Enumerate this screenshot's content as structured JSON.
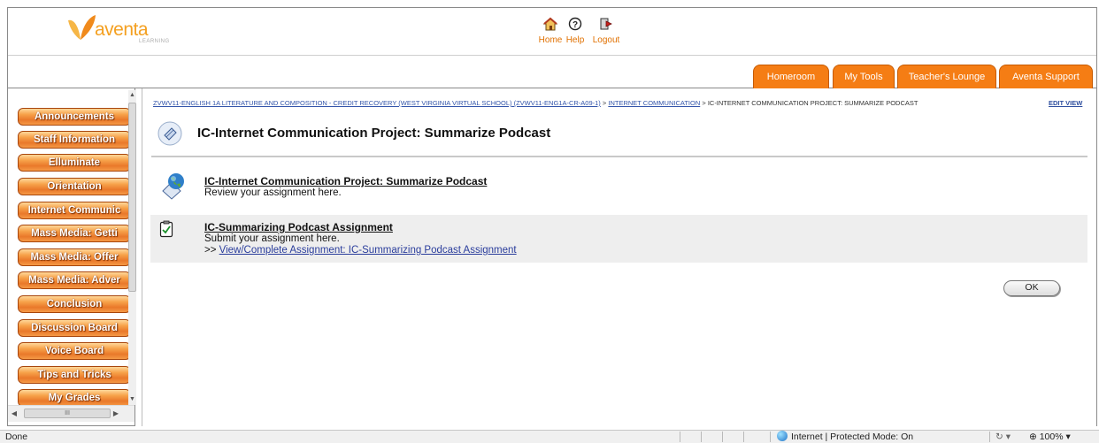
{
  "header": {
    "logo_text": "aventa",
    "logo_subtext": "LEARNING",
    "top_nav": [
      {
        "label": "Home",
        "icon": "home-icon"
      },
      {
        "label": "Help",
        "icon": "help-icon"
      },
      {
        "label": "Logout",
        "icon": "logout-icon"
      }
    ],
    "tabs": [
      "Homeroom",
      "My Tools",
      "Teacher's Lounge",
      "Aventa Support"
    ],
    "accent_color": "#f57d14"
  },
  "sidebar": {
    "items": [
      "Announcements",
      "Staff Information",
      "Elluminate",
      "Orientation",
      "Internet Communic",
      "Mass Media: Getti",
      "Mass Media: Offer",
      "Mass Media: Adver",
      "Conclusion",
      "Discussion Board",
      "Voice Board",
      "Tips and Tricks",
      "My Grades"
    ],
    "hscroll_thumb": "III"
  },
  "main": {
    "breadcrumb": {
      "course": "ZVWV11-ENGLISH 1A LITERATURE AND COMPOSITION - CREDIT RECOVERY (WEST VIRGINIA VIRTUAL SCHOOL) (ZVWV11-ENG1A-CR-A09-1)",
      "sep1": " > ",
      "section": "INTERNET COMMUNICATION",
      "sep2": " > ",
      "current": "IC-INTERNET COMMUNICATION PROJECT: SUMMARIZE PODCAST"
    },
    "edit_view": "EDIT VIEW",
    "page_title": "IC-Internet Communication Project: Summarize Podcast",
    "items": [
      {
        "title": "IC-Internet Communication Project: Summarize Podcast",
        "desc": "Review your assignment here."
      },
      {
        "title": "IC-Summarizing Podcast Assignment",
        "desc": "Submit your assignment here.",
        "link_prefix": ">> ",
        "link": "View/Complete Assignment: IC-Summarizing Podcast Assignment"
      }
    ],
    "ok_label": "OK"
  },
  "statusbar": {
    "status": "Done",
    "zone": "Internet | Protected Mode: On",
    "protected_icon": "↻ ▾",
    "zoom": "⊕ 100%  ▾"
  }
}
